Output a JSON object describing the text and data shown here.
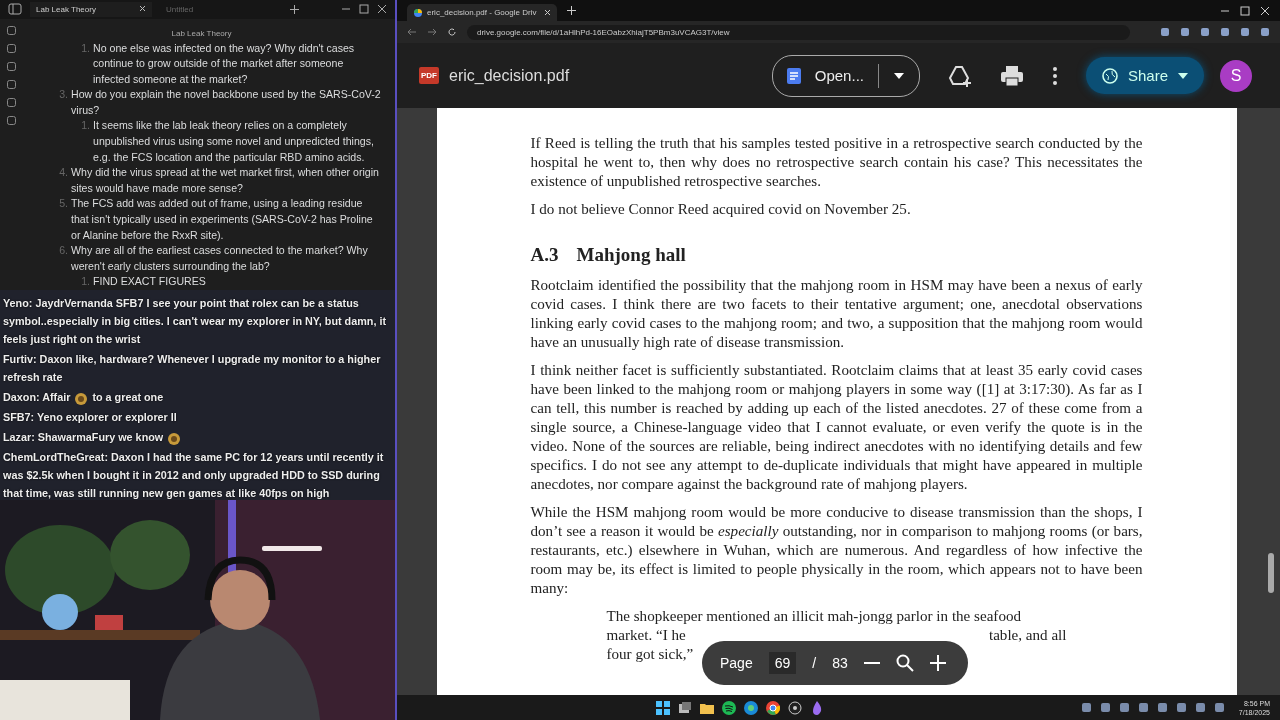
{
  "notes_app": {
    "tabs": [
      {
        "label": "Lab Leak Theory",
        "selected": true
      },
      {
        "label": "Untitled",
        "selected": false
      }
    ],
    "title": "Lab Leak Theory",
    "items": [
      {
        "children": [
          {
            "number": "1.",
            "text": "No one else was infected on the way? Why didn't cases continue to grow outside of the market after someone infected someone at the market?"
          }
        ]
      },
      {
        "number": "3.",
        "text": "How do you explain the novel backbone used by the SARS-CoV-2 virus?",
        "children": [
          {
            "number": "1.",
            "text": "It seems like the lab leak theory relies on a completely unpublished virus using some novel and unpredicted things, e.g. the FCS location and the particular RBD amino acids."
          }
        ]
      },
      {
        "number": "4.",
        "text": "Why did the virus spread at the wet market first, when other origin sites would have made more sense?"
      },
      {
        "number": "5.",
        "text": "The FCS add was added out of frame, using a leading residue that isn't typically used in experiments (SARS-CoV-2 has Proline or Alanine before the RxxR site)."
      },
      {
        "number": "6.",
        "text": "Why are all of the earliest cases connected to the market? Why weren't early clusters surrounding the lab?",
        "children": [
          {
            "number": "1.",
            "text": "FIND EXACT FIGURES"
          }
        ]
      }
    ]
  },
  "chat": [
    {
      "user": "Yeno:",
      "parts": [
        {
          "kind": "text",
          "text": "JaydrVernanda SFB7 I see your point that rolex can be a status symbol..especially in big cities. I can't wear my explorer in NY, but damn, it feels just right on the wrist"
        }
      ]
    },
    {
      "user": "Furtiv:",
      "parts": [
        {
          "kind": "text",
          "text": "Daxon like, hardware? Whenever I upgrade my monitor to a higher refresh rate"
        }
      ]
    },
    {
      "user": "Daxon:",
      "parts": [
        {
          "kind": "text",
          "text": "Affair"
        },
        {
          "kind": "emote"
        },
        {
          "kind": "text",
          "text": "to a great one"
        }
      ]
    },
    {
      "user": "SFB7:",
      "parts": [
        {
          "kind": "text",
          "text": "Yeno explorer or explorer II"
        }
      ]
    },
    {
      "user": "Lazar:",
      "parts": [
        {
          "kind": "text",
          "text": "ShawarmaFury we know"
        },
        {
          "kind": "emote"
        }
      ]
    },
    {
      "user": "ChemLordTheGreat:",
      "parts": [
        {
          "kind": "text",
          "text": "Daxon I had the same PC for 12 years until recently it was $2.5k when I bought it in 2012 and only upgraded HDD to SSD during that time, was still running new gen games at like 40fps on high"
        }
      ]
    }
  ],
  "browser": {
    "tabs": [
      {
        "label": "eric_decision.pdf - Google Driv",
        "selected": true
      }
    ],
    "url": "drive.google.com/file/d/1aHlhPd-16EOabzXhiajT5PBm3uVCAG3T/view",
    "file_name": "eric_decision.pdf",
    "file_badge": "PDF",
    "open_button": "Open...",
    "share_button": "Share",
    "avatar": "S"
  },
  "document": {
    "blocks": [
      {
        "kind": "para",
        "text": "If Reed is telling the truth that his samples tested positive in a retrospective search conducted by the hospital he went to, then why does no retrospective search contain his case?  This necessitates the existence of unpublished retrospective searches."
      },
      {
        "kind": "para",
        "text": "I do not believe Connor Reed acquired covid on November 25."
      },
      {
        "kind": "heading",
        "number": "A.3",
        "text": "Mahjong hall"
      },
      {
        "kind": "para",
        "text": "Rootclaim identified the possibility that the mahjong room in HSM may have been a nexus of early covid cases. I think there are two facets to their tentative argument; one, anecdotal observations linking early covid cases to the mahjong room; and two, a supposition that the mahjong room would have an unusually high rate of disease transmission."
      },
      {
        "kind": "para",
        "text": "I think neither facet is sufficiently substantiated.  Rootclaim claims that at least 35 early covid cases have been linked to the mahjong room or mahjong players in some way ([1] at 3:17:30).  As far as I can tell, this number is reached by adding up each of the listed anecdotes.  27 of these come from a single source, a Chinese-language video that I cannot evaluate, or even verify the quote is in the video.  None of the sources are reliable, being indirect anecdotes with no identifying details and few specifics.  I do not see any attempt to de-duplicate individuals that might have appeared in multiple anecdotes, nor compare against the background rate of mahjong players."
      },
      {
        "kind": "para",
        "text": "While the HSM mahjong room would be more conducive to disease transmission than the shops, I don’t see a reason it would be *especially* outstanding, nor in comparison to mahjong rooms (or bars, restaurants, etc.) elsewhere in Wuhan, which are numerous.  And regardless of how infective the room may be, its effect is limited to people physically in the room, which appears not to have been many:"
      }
    ],
    "quote": {
      "line_1": "The shopkeeper mentioned an illicit mah-jongg parlor in the seafood",
      "line_2_start": "market.  “I he",
      "line_2_end": "table, and all",
      "line_3": "four got sick,”"
    },
    "page_bar": {
      "label": "Page",
      "current": "69",
      "separator": "/",
      "total": "83"
    }
  },
  "taskbar": {
    "time": "8:56 PM",
    "date": "7/18/2025"
  }
}
